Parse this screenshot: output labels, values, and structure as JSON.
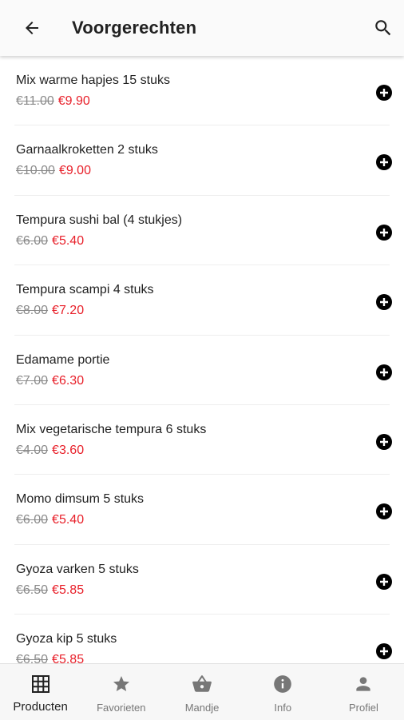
{
  "header": {
    "title": "Voorgerechten",
    "back_icon": "arrow-left-icon",
    "search_icon": "search-icon"
  },
  "products": [
    {
      "name": "Mix warme hapjes 15 stuks",
      "old_price": "€11.00",
      "price": "€9.90"
    },
    {
      "name": "Garnaalkroketten 2 stuks",
      "old_price": "€10.00",
      "price": "€9.00"
    },
    {
      "name": "Tempura sushi bal (4 stukjes)",
      "old_price": "€6.00",
      "price": "€5.40"
    },
    {
      "name": "Tempura scampi 4 stuks",
      "old_price": "€8.00",
      "price": "€7.20"
    },
    {
      "name": "Edamame portie",
      "old_price": "€7.00",
      "price": "€6.30"
    },
    {
      "name": "Mix vegetarische tempura 6 stuks",
      "old_price": "€4.00",
      "price": "€3.60"
    },
    {
      "name": "Momo dimsum 5 stuks",
      "old_price": "€6.00",
      "price": "€5.40"
    },
    {
      "name": "Gyoza varken 5 stuks",
      "old_price": "€6.50",
      "price": "€5.85"
    },
    {
      "name": "Gyoza kip 5 stuks",
      "old_price": "€6.50",
      "price": "€5.85"
    }
  ],
  "bottom_nav": [
    {
      "label": "Producten",
      "icon": "grid-icon",
      "active": true
    },
    {
      "label": "Favorieten",
      "icon": "star-icon",
      "active": false
    },
    {
      "label": "Mandje",
      "icon": "basket-icon",
      "active": false
    },
    {
      "label": "Info",
      "icon": "info-icon",
      "active": false
    },
    {
      "label": "Profiel",
      "icon": "person-icon",
      "active": false
    }
  ],
  "colors": {
    "sale_price": "#e8202a",
    "old_price": "#8a8a8a",
    "text": "#212121",
    "nav_inactive": "#777777"
  }
}
